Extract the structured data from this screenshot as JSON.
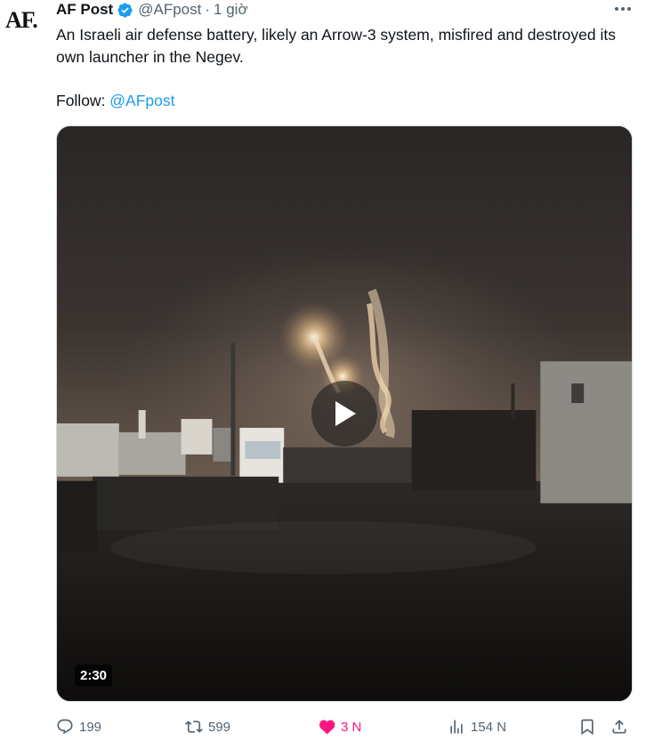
{
  "tweet": {
    "avatar_text": "AF.",
    "display_name": "AF Post",
    "handle": "@AFpost",
    "separator": "·",
    "time": "1 giờ",
    "text": "An Israeli air defense battery, likely an Arrow-3 system, misfired and destroyed its own launcher in the Negev.",
    "follow_label": "Follow: ",
    "follow_mention": "@AFpost"
  },
  "media": {
    "duration": "2:30"
  },
  "actions": {
    "replies": "199",
    "reposts": "599",
    "likes": "3 N",
    "views": "154 N"
  },
  "colors": {
    "accent": "#1d9bf0",
    "like": "#f91880",
    "muted": "#536471"
  },
  "icons": [
    "verified-badge-icon",
    "more-icon",
    "play-icon",
    "reply-icon",
    "repost-icon",
    "heart-icon",
    "views-icon",
    "bookmark-icon",
    "share-icon"
  ]
}
